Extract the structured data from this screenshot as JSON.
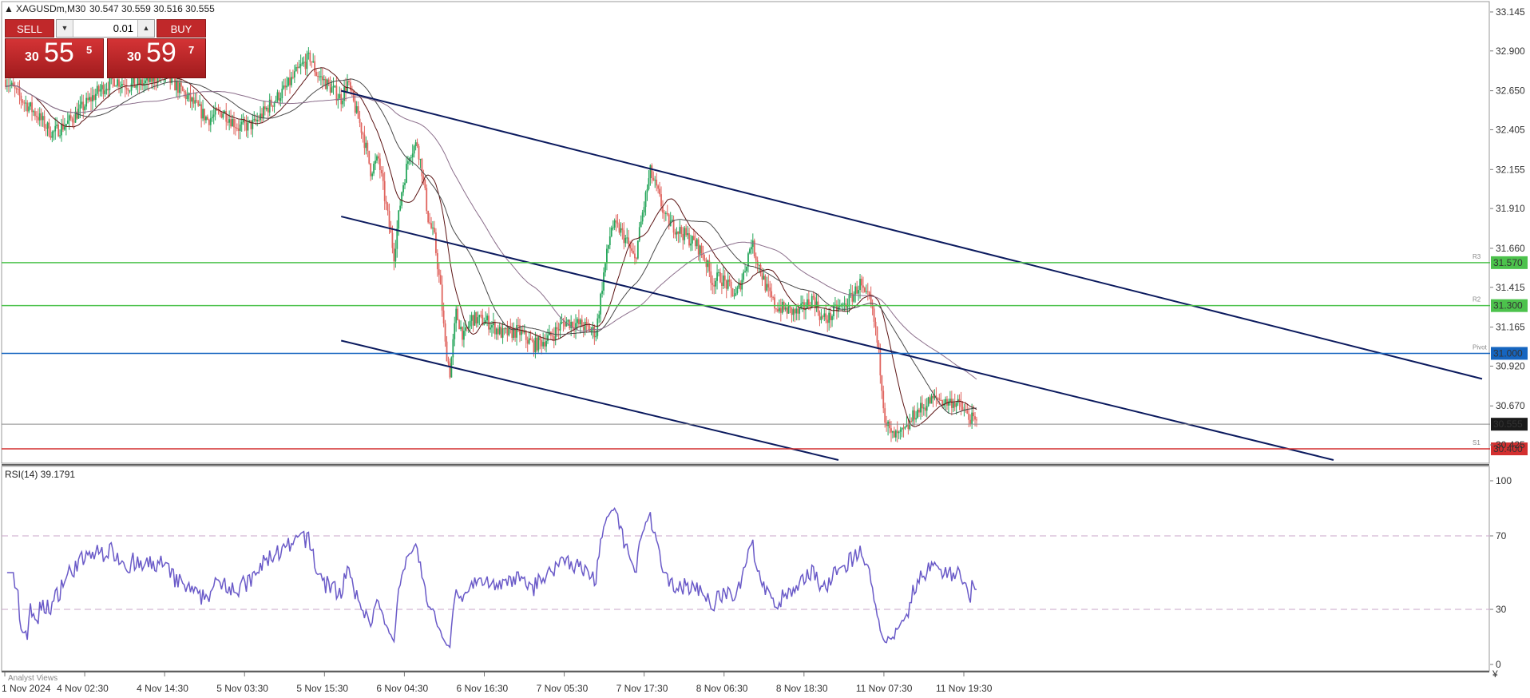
{
  "header": {
    "symbol_info": "XAGUSDm,M30",
    "ohlc": "30.547 30.559 30.516 30.555"
  },
  "trade_panel": {
    "sell_label": "SELL",
    "buy_label": "BUY",
    "lot_value": "0.01",
    "sell_price": {
      "small": "30",
      "big": "55",
      "sup": "5"
    },
    "buy_price": {
      "small": "30",
      "big": "59",
      "sup": "7"
    }
  },
  "indicator_label": "RSI(14) 39.1791",
  "footer_label": "Analyst Views",
  "colors": {
    "bull": "#26a65b",
    "bear": "#e0645e",
    "pivot": "#1565c0",
    "level_green": "#4cc24c",
    "level_red": "#d32f2f",
    "channel": "#0b1a5e",
    "ma_dark": "#5c1414",
    "ma_light": "#8b6e8b",
    "rsi": "#6a5ac8",
    "current_price_bg": "#1a1a1a"
  },
  "chart_data": [
    {
      "type": "candlestick",
      "symbol": "XAGUSDm",
      "timeframe": "M30",
      "ylim": [
        30.32,
        33.2
      ],
      "y_ticks": [
        "33.145",
        "32.900",
        "32.650",
        "32.405",
        "32.155",
        "31.910",
        "31.660",
        "31.415",
        "31.165",
        "30.920",
        "30.670",
        "30.425"
      ],
      "x_ticks": [
        "1 Nov 2024",
        "4 Nov 02:30",
        "4 Nov 14:30",
        "5 Nov 03:30",
        "5 Nov 15:30",
        "6 Nov 04:30",
        "6 Nov 16:30",
        "7 Nov 05:30",
        "7 Nov 17:30",
        "8 Nov 06:30",
        "8 Nov 18:30",
        "11 Nov 07:30",
        "11 Nov 19:30"
      ],
      "price_path": [
        [
          0,
          32.72
        ],
        [
          10,
          32.6
        ],
        [
          20,
          32.5
        ],
        [
          30,
          32.38
        ],
        [
          40,
          32.45
        ],
        [
          50,
          32.55
        ],
        [
          60,
          32.65
        ],
        [
          70,
          32.72
        ],
        [
          80,
          32.68
        ],
        [
          90,
          32.7
        ],
        [
          100,
          32.75
        ],
        [
          110,
          32.68
        ],
        [
          120,
          32.58
        ],
        [
          130,
          32.47
        ],
        [
          140,
          32.52
        ],
        [
          150,
          32.42
        ],
        [
          160,
          32.44
        ],
        [
          170,
          32.56
        ],
        [
          180,
          32.66
        ],
        [
          190,
          32.8
        ],
        [
          196,
          32.86
        ],
        [
          200,
          32.76
        ],
        [
          210,
          32.66
        ],
        [
          216,
          32.6
        ],
        [
          220,
          32.7
        ],
        [
          225,
          32.54
        ],
        [
          230,
          32.38
        ],
        [
          235,
          32.15
        ],
        [
          240,
          32.22
        ],
        [
          245,
          31.92
        ],
        [
          250,
          31.62
        ],
        [
          255,
          32.02
        ],
        [
          260,
          32.26
        ],
        [
          265,
          32.32
        ],
        [
          268,
          32.15
        ],
        [
          272,
          31.85
        ],
        [
          276,
          31.72
        ],
        [
          280,
          31.4
        ],
        [
          283,
          31.05
        ],
        [
          286,
          30.88
        ],
        [
          290,
          31.25
        ],
        [
          295,
          31.1
        ],
        [
          300,
          31.22
        ],
        [
          310,
          31.2
        ],
        [
          320,
          31.12
        ],
        [
          330,
          31.14
        ],
        [
          340,
          31.05
        ],
        [
          350,
          31.1
        ],
        [
          360,
          31.2
        ],
        [
          370,
          31.18
        ],
        [
          380,
          31.13
        ],
        [
          385,
          31.5
        ],
        [
          390,
          31.8
        ],
        [
          395,
          31.78
        ],
        [
          400,
          31.7
        ],
        [
          405,
          31.58
        ],
        [
          410,
          31.88
        ],
        [
          415,
          32.14
        ],
        [
          420,
          32.0
        ],
        [
          425,
          31.84
        ],
        [
          430,
          31.8
        ],
        [
          440,
          31.72
        ],
        [
          445,
          31.68
        ],
        [
          450,
          31.6
        ],
        [
          455,
          31.45
        ],
        [
          460,
          31.48
        ],
        [
          470,
          31.36
        ],
        [
          475,
          31.5
        ],
        [
          480,
          31.7
        ],
        [
          485,
          31.55
        ],
        [
          490,
          31.4
        ],
        [
          495,
          31.3
        ],
        [
          500,
          31.28
        ],
        [
          510,
          31.25
        ],
        [
          520,
          31.35
        ],
        [
          525,
          31.22
        ],
        [
          530,
          31.22
        ],
        [
          535,
          31.28
        ],
        [
          540,
          31.3
        ],
        [
          545,
          31.36
        ],
        [
          550,
          31.44
        ],
        [
          553,
          31.35
        ],
        [
          556,
          31.34
        ],
        [
          560,
          31.15
        ],
        [
          563,
          30.9
        ],
        [
          566,
          30.6
        ],
        [
          570,
          30.48
        ],
        [
          575,
          30.48
        ],
        [
          580,
          30.52
        ],
        [
          585,
          30.62
        ],
        [
          590,
          30.66
        ],
        [
          595,
          30.7
        ],
        [
          600,
          30.72
        ],
        [
          605,
          30.69
        ],
        [
          610,
          30.7
        ],
        [
          615,
          30.66
        ],
        [
          620,
          30.6
        ],
        [
          625,
          30.56
        ]
      ],
      "indicators": {
        "moving_averages": 3,
        "horizontal_levels": [
          {
            "value": 31.57,
            "label": "31.570",
            "tag": "R3",
            "color": "green"
          },
          {
            "value": 31.3,
            "label": "31.300",
            "tag": "R2",
            "color": "green"
          },
          {
            "value": 31.0,
            "label": "31.000",
            "tag": "Pivot",
            "color": "blue"
          },
          {
            "value": 30.555,
            "label": "30.555",
            "tag": "",
            "color": "current"
          },
          {
            "value": 30.4,
            "label": "30.400",
            "tag": "S1",
            "color": "red"
          }
        ],
        "channels": 3
      },
      "grid": false
    },
    {
      "type": "line",
      "title": "RSI(14) 39.1791",
      "ylim": [
        0,
        100
      ],
      "y_ticks": [
        "100",
        "70",
        "30",
        "0"
      ],
      "levels": [
        70,
        30
      ],
      "last_value": 39.1791
    }
  ]
}
